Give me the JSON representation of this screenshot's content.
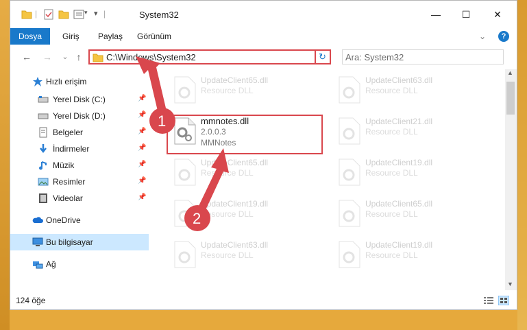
{
  "window": {
    "title": "System32",
    "minimize_glyph": "—",
    "maximize_glyph": "☐",
    "close_glyph": "✕"
  },
  "ribbon": {
    "tabs": [
      "Dosya",
      "Giriş",
      "Paylaş",
      "Görünüm"
    ],
    "expand_glyph": "⌄",
    "help_glyph": "?"
  },
  "address": {
    "path": "C:\\Windows\\System32",
    "refresh_glyph": "↻",
    "search_placeholder": "Ara: System32",
    "back_glyph": "←",
    "forward_glyph": "→",
    "recent_glyph": "⌄",
    "up_glyph": "↑"
  },
  "sidebar": {
    "items": [
      {
        "label": "Hızlı erişim",
        "icon": "star-icon",
        "pinned": false
      },
      {
        "label": "Yerel Disk (C:)",
        "icon": "drive-icon",
        "pinned": true
      },
      {
        "label": "Yerel Disk (D:)",
        "icon": "drive-icon",
        "pinned": true
      },
      {
        "label": "Belgeler",
        "icon": "document-icon",
        "pinned": true
      },
      {
        "label": "İndirmeler",
        "icon": "download-icon",
        "pinned": true
      },
      {
        "label": "Müzik",
        "icon": "music-icon",
        "pinned": true
      },
      {
        "label": "Resimler",
        "icon": "pictures-icon",
        "pinned": true
      },
      {
        "label": "Videolar",
        "icon": "video-icon",
        "pinned": true
      },
      {
        "label": "OneDrive",
        "icon": "cloud-icon",
        "pinned": false
      },
      {
        "label": "Bu bilgisayar",
        "icon": "computer-icon",
        "pinned": false,
        "selected": true
      },
      {
        "label": "Ağ",
        "icon": "network-icon",
        "pinned": false
      }
    ]
  },
  "files": [
    {
      "name": "UpdateClient65.dll",
      "type": "Resource DLL"
    },
    {
      "name": "UpdateClient63.dll",
      "type": "Resource DLL"
    },
    {
      "name": "mmnotes.dll",
      "version": "2.0.0.3",
      "description": "MMNotes"
    },
    {
      "name": "UpdateClient21.dll",
      "type": "Resource DLL"
    },
    {
      "name": "UpdateClient65.dll",
      "type": "Resource DLL"
    },
    {
      "name": "UpdateClient19.dll",
      "type": "Resource DLL"
    },
    {
      "name": "UpdateClient19.dll",
      "type": "Resource DLL"
    },
    {
      "name": "UpdateClient65.dll",
      "type": "Resource DLL"
    },
    {
      "name": "UpdateClient63.dll",
      "type": "Resource DLL"
    },
    {
      "name": "UpdateClient19.dll",
      "type": "Resource DLL"
    }
  ],
  "status": {
    "count": "124 öğe"
  },
  "annotations": {
    "step1": "1",
    "step2": "2",
    "color": "#d9474d"
  }
}
